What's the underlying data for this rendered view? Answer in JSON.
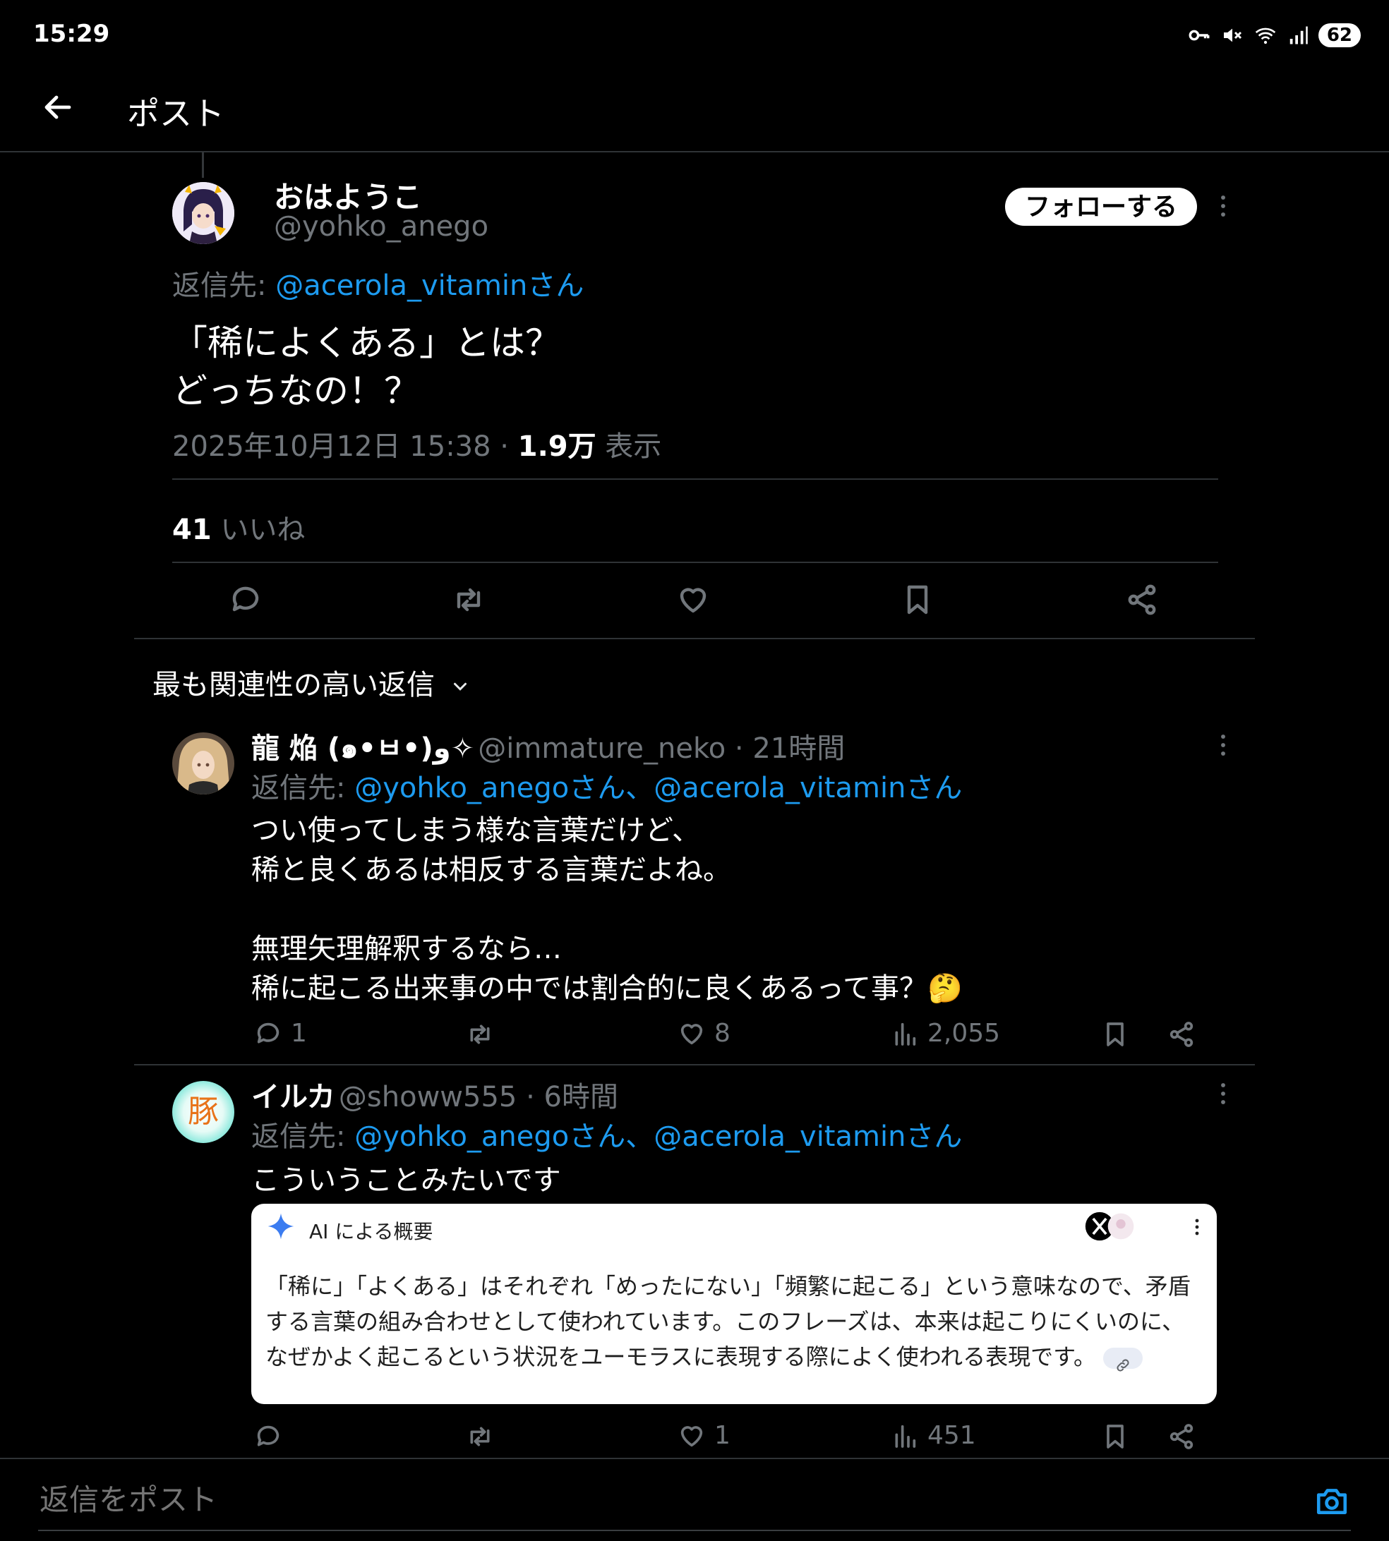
{
  "status_bar": {
    "time": "15:29",
    "battery": "62"
  },
  "header": {
    "title": "ポスト"
  },
  "main_post": {
    "name": "おはようこ",
    "handle": "@yohko_anego",
    "follow_label": "フォローする",
    "reply_label": "返信先:",
    "reply_to": "@acerola_vitaminさん",
    "text_line1": "「稀によくある」とは？",
    "text_line2": "どっちなの！？",
    "datetime": "2025年10月12日 15:38 · ",
    "views_count": "1.9万",
    "views_label": " 表示",
    "likes_count": "41",
    "likes_label": " いいね"
  },
  "section": {
    "title": "最も関連性の高い返信"
  },
  "replies": [
    {
      "name": "龍 焔 (๑•ㅂ•)و✧",
      "handle": "@immature_neko",
      "time": " · 21時間",
      "reply_label": "返信先:",
      "reply_to": "@yohko_anegoさん、@acerola_vitaminさん",
      "lines": [
        "つい使ってしまう様な言葉だけど、",
        "稀と良くあるは相反する言葉だよね。",
        "無理矢理解釈するなら…",
        "稀に起こる出来事の中では割合的に良くあるって事？🤔"
      ],
      "replies": "1",
      "likes": "8",
      "views": "2,055"
    },
    {
      "name": "イルカ",
      "handle": "@showw555",
      "time": " · 6時間",
      "reply_label": "返信先:",
      "reply_to": "@yohko_anegoさん、@acerola_vitaminさん",
      "lines": [
        "こういうことみたいです"
      ],
      "replies": "",
      "likes": "1",
      "views": "451",
      "avatar_text": "豚",
      "card": {
        "title": "AI による概要",
        "body": "「稀に」「よくある」はそれぞれ「めったにない」「頻繁に起こる」という意味なので、矛盾する言葉の組み合わせとして使われています。このフレーズは、本来は起こりにくいのに、なぜかよく起こるという状況をユーモラスに表現する際によく使われる表現です。"
      }
    }
  ],
  "compose": {
    "placeholder": "返信をポスト"
  }
}
